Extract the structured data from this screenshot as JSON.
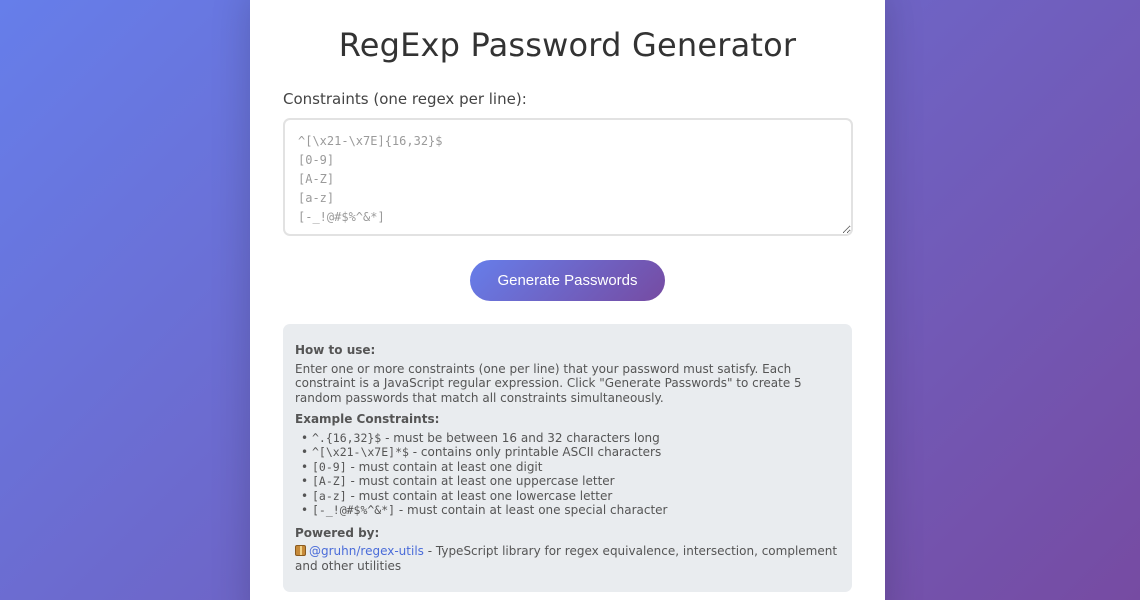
{
  "page": {
    "title": "RegExp Password Generator"
  },
  "constraints": {
    "label": "Constraints (one regex per line):",
    "placeholder": "^[\\x21-\\x7E]{16,32}$\n[0-9]\n[A-Z]\n[a-z]\n[-_!@#$%^&*]"
  },
  "generate_button": {
    "label": "Generate Passwords"
  },
  "info": {
    "how_to_heading": "How to use:",
    "how_to_text": "Enter one or more constraints (one per line) that your password must satisfy. Each constraint is a JavaScript regular expression. Click \"Generate Passwords\" to create 5 random passwords that match all constraints simultaneously.",
    "examples_heading": "Example Constraints:",
    "examples": [
      {
        "code": "^.{16,32}$",
        "desc": " - must be between 16 and 32 characters long"
      },
      {
        "code": "^[\\x21-\\x7E]*$",
        "desc": " - contains only printable ASCII characters"
      },
      {
        "code": "[0-9]",
        "desc": " - must contain at least one digit"
      },
      {
        "code": "[A-Z]",
        "desc": " - must contain at least one uppercase letter"
      },
      {
        "code": "[a-z]",
        "desc": " - must contain at least one lowercase letter"
      },
      {
        "code": "[-_!@#$%^&*]",
        "desc": " - must contain at least one special character"
      }
    ],
    "powered_heading": "Powered by:",
    "powered_link": "@gruhn/regex-utils",
    "powered_text": " - TypeScript library for regex equivalence, intersection, complement and other utilities",
    "powered_icon": "package-icon"
  },
  "colors": {
    "gradient_start": "#667eea",
    "gradient_end": "#764ba2",
    "info_background": "#e9ecef",
    "link": "#4a6cd9"
  }
}
